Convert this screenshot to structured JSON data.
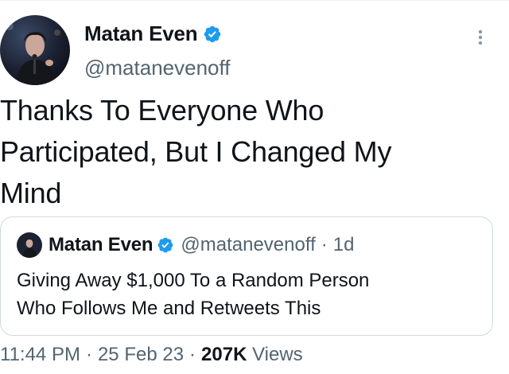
{
  "colors": {
    "verified": "#1d9bf0",
    "secondary_text": "#536471",
    "primary_text": "#0f1419",
    "border": "#cfd9de"
  },
  "tweet": {
    "author": {
      "display_name": "Matan Even",
      "handle": "@matanevenoff",
      "verified": true,
      "avatar_icon": "avatar-photo"
    },
    "more_icon": "more-options-icon",
    "text_lines": [
      "Thanks To Everyone Who",
      "Participated, But I Changed My",
      "Mind"
    ],
    "quoted": {
      "display_name": "Matan Even",
      "handle": "@matanevenoff",
      "separator": "·",
      "age": "1d",
      "verified": true,
      "text_lines": [
        "Giving Away $1,000 To a Random Person",
        "Who Follows Me and Retweets This"
      ]
    },
    "meta": {
      "time": "11:44 PM",
      "separator": "·",
      "date": "25 Feb 23",
      "views_count": "207K",
      "views_label": "Views"
    }
  }
}
